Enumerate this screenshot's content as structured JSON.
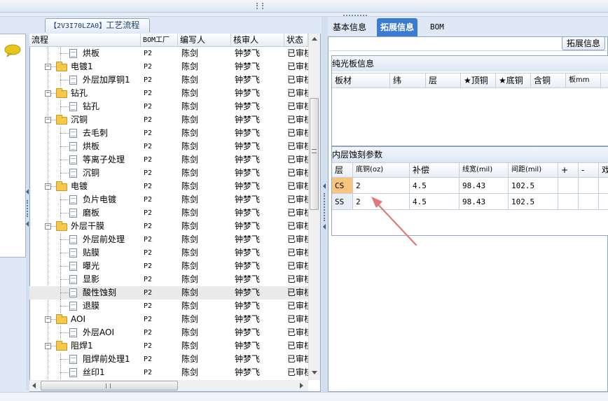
{
  "tree_panel": {
    "title_prefix": "【2V3I70LZA0】",
    "title_suffix": "工艺流程",
    "columns": [
      "流程",
      "BOM工厂",
      "编写人",
      "核审人",
      "状态"
    ],
    "rows": [
      {
        "label": "烘板",
        "type": "doc",
        "level": 2,
        "bom": "P2",
        "writer": "陈剑",
        "reviewer": "钟梦飞",
        "status": "已审核"
      },
      {
        "label": "电镀1",
        "type": "folder",
        "level": 1,
        "bom": "P2",
        "writer": "陈剑",
        "reviewer": "钟梦飞",
        "status": "已审核"
      },
      {
        "label": "外层加厚铜1",
        "type": "doc",
        "level": 2,
        "bom": "P2",
        "writer": "陈剑",
        "reviewer": "钟梦飞",
        "status": "已审核"
      },
      {
        "label": "钻孔",
        "type": "folder",
        "level": 1,
        "bom": "P2",
        "writer": "陈剑",
        "reviewer": "钟梦飞",
        "status": "已审核"
      },
      {
        "label": "钻孔",
        "type": "doc",
        "level": 2,
        "bom": "P2",
        "writer": "陈剑",
        "reviewer": "钟梦飞",
        "status": "已审核"
      },
      {
        "label": "沉铜",
        "type": "folder",
        "level": 1,
        "bom": "P2",
        "writer": "陈剑",
        "reviewer": "钟梦飞",
        "status": "已审核"
      },
      {
        "label": "去毛刺",
        "type": "doc",
        "level": 2,
        "bom": "P2",
        "writer": "陈剑",
        "reviewer": "钟梦飞",
        "status": "已审核"
      },
      {
        "label": "烘板",
        "type": "doc",
        "level": 2,
        "bom": "P2",
        "writer": "陈剑",
        "reviewer": "钟梦飞",
        "status": "已审核"
      },
      {
        "label": "等离子处理",
        "type": "doc",
        "level": 2,
        "bom": "P2",
        "writer": "陈剑",
        "reviewer": "钟梦飞",
        "status": "已审核"
      },
      {
        "label": "沉铜",
        "type": "doc",
        "level": 2,
        "bom": "P2",
        "writer": "陈剑",
        "reviewer": "钟梦飞",
        "status": "已审核"
      },
      {
        "label": "电镀",
        "type": "folder",
        "level": 1,
        "bom": "P2",
        "writer": "陈剑",
        "reviewer": "钟梦飞",
        "status": "已审核"
      },
      {
        "label": "负片电镀",
        "type": "doc",
        "level": 2,
        "bom": "P2",
        "writer": "陈剑",
        "reviewer": "钟梦飞",
        "status": "已审核"
      },
      {
        "label": "磨板",
        "type": "doc",
        "level": 2,
        "bom": "P2",
        "writer": "陈剑",
        "reviewer": "钟梦飞",
        "status": "已审核"
      },
      {
        "label": "外层干膜",
        "type": "folder",
        "level": 1,
        "bom": "P2",
        "writer": "陈剑",
        "reviewer": "钟梦飞",
        "status": "已审核"
      },
      {
        "label": "外层前处理",
        "type": "doc",
        "level": 2,
        "bom": "P2",
        "writer": "陈剑",
        "reviewer": "钟梦飞",
        "status": "已审核"
      },
      {
        "label": "贴膜",
        "type": "doc",
        "level": 2,
        "bom": "P2",
        "writer": "陈剑",
        "reviewer": "钟梦飞",
        "status": "已审核"
      },
      {
        "label": "曝光",
        "type": "doc",
        "level": 2,
        "bom": "P2",
        "writer": "陈剑",
        "reviewer": "钟梦飞",
        "status": "已审核"
      },
      {
        "label": "显影",
        "type": "doc",
        "level": 2,
        "bom": "P2",
        "writer": "陈剑",
        "reviewer": "钟梦飞",
        "status": "已审核"
      },
      {
        "label": "酸性蚀刻",
        "type": "doc",
        "level": 2,
        "bom": "P2",
        "writer": "陈剑",
        "reviewer": "钟梦飞",
        "status": "已审核",
        "selected": true
      },
      {
        "label": "退膜",
        "type": "doc",
        "level": 2,
        "bom": "P2",
        "writer": "陈剑",
        "reviewer": "钟梦飞",
        "status": "已审核"
      },
      {
        "label": "AOI",
        "type": "folder",
        "level": 1,
        "bom": "P2",
        "writer": "陈剑",
        "reviewer": "钟梦飞",
        "status": "已审核"
      },
      {
        "label": "外层AOI",
        "type": "doc",
        "level": 2,
        "bom": "P2",
        "writer": "陈剑",
        "reviewer": "钟梦飞",
        "status": "已审核"
      },
      {
        "label": "阻焊1",
        "type": "folder",
        "level": 1,
        "bom": "P2",
        "writer": "陈剑",
        "reviewer": "钟梦飞",
        "status": "已审核"
      },
      {
        "label": "阻焊前处理1",
        "type": "doc",
        "level": 2,
        "bom": "P2",
        "writer": "陈剑",
        "reviewer": "钟梦飞",
        "status": "已审核"
      },
      {
        "label": "丝印1",
        "type": "doc",
        "level": 2,
        "bom": "P2",
        "writer": "陈剑",
        "reviewer": "钟梦飞",
        "status": "已审核"
      }
    ]
  },
  "right_panel": {
    "tabs": [
      "基本信息",
      "拓展信息",
      "BOM"
    ],
    "active_tab": 1,
    "sub_label": "拓展信息",
    "grid1": {
      "title": "纯光板信息",
      "columns": [
        "板材",
        "纬",
        "层",
        "★顶铜",
        "★底铜",
        "含铜",
        "板mm"
      ]
    },
    "grid2": {
      "title": "内层蚀刻参数",
      "columns": [
        "层",
        "底铜(oz)",
        "补偿",
        "线宽(mil)",
        "间距(mil)",
        "+",
        "-",
        "戏"
      ],
      "rows": [
        {
          "layer": "CS",
          "base_copper": "2",
          "compensation": "4.5",
          "line_width": "98.43",
          "spacing": "102.5",
          "active": true
        },
        {
          "layer": "SS",
          "base_copper": "2",
          "compensation": "4.5",
          "line_width": "98.43",
          "spacing": "102.5",
          "active": false
        }
      ]
    }
  },
  "colors": {
    "active_tab": "#3b7bd0",
    "selected_layer": "#f9c47c",
    "annotation_arrow": "#e07a7a",
    "folder": "#f5c84c"
  }
}
